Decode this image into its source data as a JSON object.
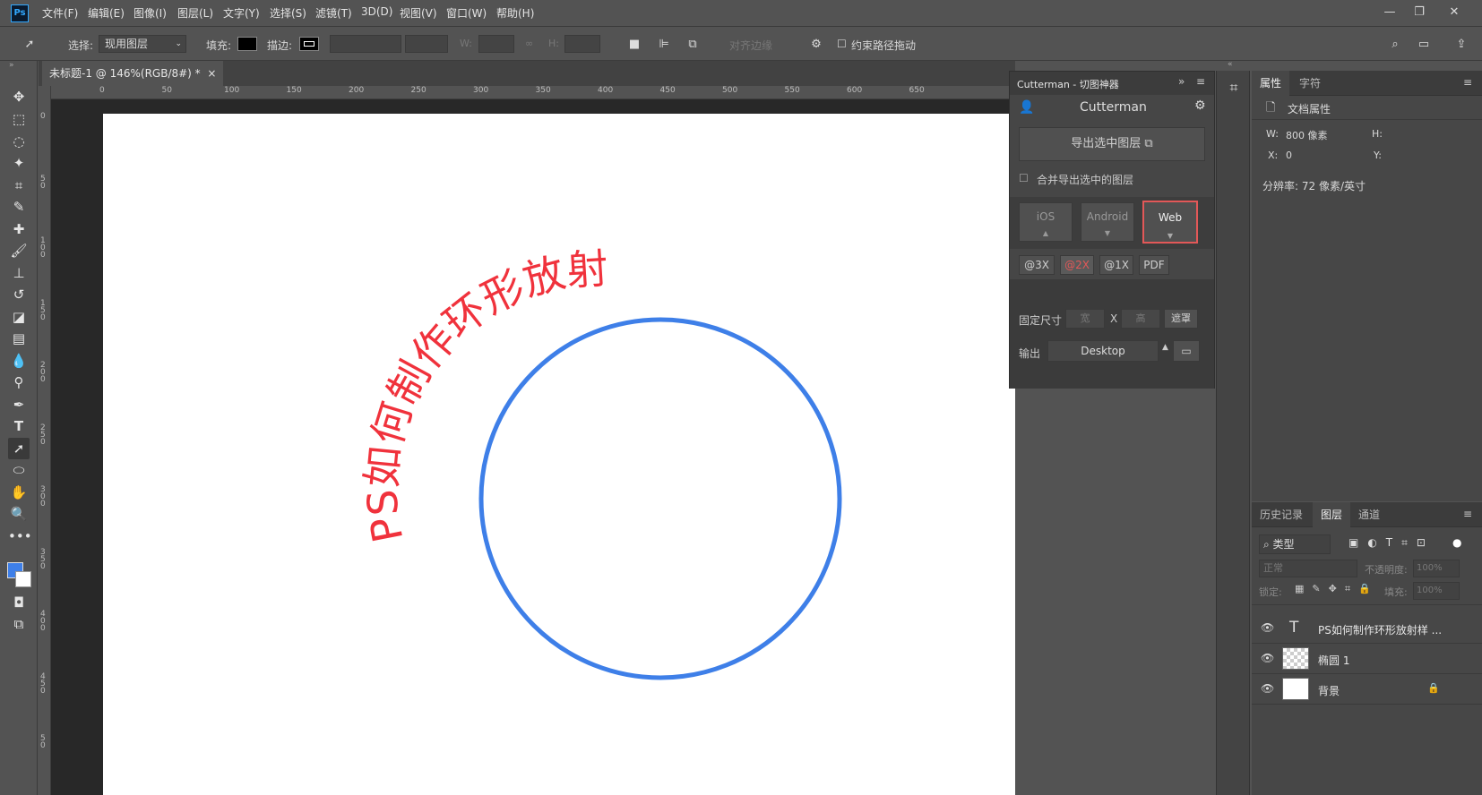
{
  "app": {
    "logo": "Ps"
  },
  "menu": [
    "文件(F)",
    "编辑(E)",
    "图像(I)",
    "图层(L)",
    "文字(Y)",
    "选择(S)",
    "滤镜(T)",
    "3D(D)",
    "视图(V)",
    "窗口(W)",
    "帮助(H)"
  ],
  "window_controls": {
    "minimize": "—",
    "restore": "❐",
    "close": "✕"
  },
  "options": {
    "select_label": "选择:",
    "select_value": "现用图层",
    "fill_label": "填充:",
    "stroke_label": "描边:",
    "w_label": "W:",
    "h_label": "H:",
    "align_edges": "对齐边缘",
    "constrain_path": "约束路径拖动"
  },
  "doc_tab": {
    "title": "未标题-1 @ 146%(RGB/8#) *",
    "close": "×"
  },
  "ruler": {
    "h": [
      "0",
      "50",
      "100",
      "150",
      "200",
      "250",
      "300",
      "350",
      "400",
      "450",
      "500",
      "550",
      "600",
      "650"
    ],
    "v": [
      "0",
      "5 0",
      "1 0 0",
      "1 5 0",
      "2 0 0",
      "2 5 0",
      "3 0 0",
      "3 5 0",
      "4 0 0",
      "4 5 0",
      "5 0"
    ]
  },
  "canvas": {
    "arc_text": "PS如何制作环形放射",
    "text_color": "#f0323c",
    "circle_color": "#3e7fe8"
  },
  "cutterman": {
    "title": "Cutterman - 切图神器",
    "brand": "Cutterman",
    "export_btn": "导出选中图层",
    "merge_label": "合并导出选中的图层",
    "platforms": [
      "iOS",
      "Android",
      "Web"
    ],
    "active_platform": "Web",
    "scales": [
      "@3X",
      "@2X",
      "@1X",
      "PDF"
    ],
    "active_scale": "@2X",
    "fixed_size_label": "固定尺寸",
    "width_ph": "宽",
    "x_sep": "X",
    "height_ph": "高",
    "mask_btn": "遮罩",
    "output_label": "输出",
    "output_value": "Desktop"
  },
  "properties": {
    "tabs": [
      "属性",
      "字符"
    ],
    "doc_props": "文档属性",
    "w_label": "W:",
    "w_value": "800 像素",
    "h_label": "H:",
    "x_label": "X:",
    "x_value": "0",
    "y_label": "Y:",
    "resolution": "分辨率: 72 像素/英寸"
  },
  "layers_panel": {
    "tabs": [
      "历史记录",
      "图层",
      "通道"
    ],
    "filter": "类型",
    "blend": "正常",
    "opacity_label": "不透明度:",
    "opacity_value": "100%",
    "lock_label": "锁定:",
    "fill_label": "填充:",
    "fill_value": "100%",
    "layers": [
      {
        "name": "PS如何制作环形放射样 ..."
      },
      {
        "name": "椭圆 1"
      },
      {
        "name": "背景"
      }
    ]
  }
}
